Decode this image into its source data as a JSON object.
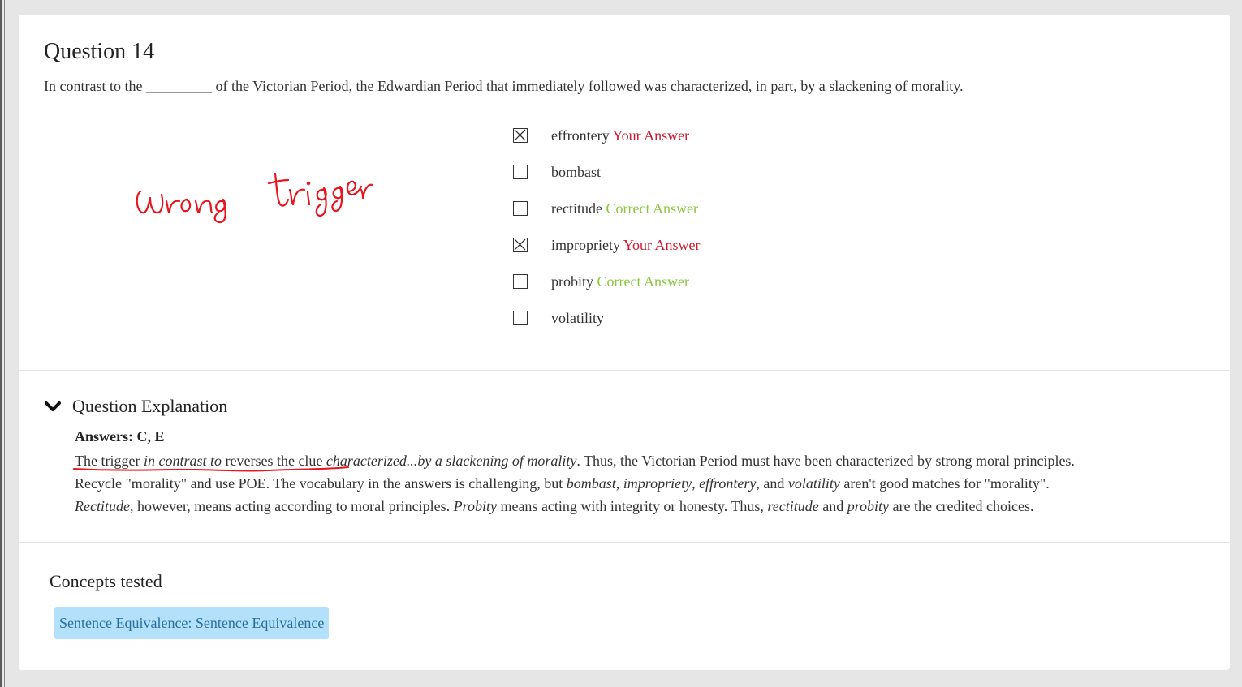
{
  "question": {
    "title": "Question 14",
    "stem": "In contrast to the _________ of the Victorian Period, the Edwardian Period that immediately followed was characterized, in part, by a slackening of morality."
  },
  "options": [
    {
      "text": "effrontery",
      "checked": true,
      "tag": "Your Answer",
      "tag_type": "wrong"
    },
    {
      "text": "bombast",
      "checked": false,
      "tag": "",
      "tag_type": ""
    },
    {
      "text": "rectitude",
      "checked": false,
      "tag": "Correct Answer",
      "tag_type": "right"
    },
    {
      "text": "impropriety",
      "checked": true,
      "tag": "Your Answer",
      "tag_type": "wrong"
    },
    {
      "text": "probity",
      "checked": false,
      "tag": "Correct Answer",
      "tag_type": "right"
    },
    {
      "text": "volatility",
      "checked": false,
      "tag": "",
      "tag_type": ""
    }
  ],
  "annotation": {
    "handwriting": "wrong trigger",
    "color": "#e8141e"
  },
  "explanation": {
    "heading": "Question Explanation",
    "answers": "Answers: C, E",
    "p1_a": "The trigger ",
    "p1_b": "in contrast to",
    "p1_c": " reverses the clue ",
    "p1_d": "characterized...by a slackening of morality",
    "p1_e": ". Thus, the Victorian Period must have been characterized by strong moral principles.",
    "p2_a": "Recycle \"morality\" and use POE. The vocabulary in the answers is challenging, but ",
    "p2_b": "bombast",
    "p2_c": ", ",
    "p2_d": "impropriety",
    "p2_e": ", ",
    "p2_f": "effrontery",
    "p2_g": ", and ",
    "p2_h": "volatility",
    "p2_i": " aren't good matches for \"morality\".",
    "p3_a": "Rectitude",
    "p3_b": ", however, means acting according to moral principles. ",
    "p3_c": "Probity",
    "p3_d": " means acting with integrity or honesty. Thus, ",
    "p3_e": "rectitude",
    "p3_f": " and ",
    "p3_g": "probity",
    "p3_h": " are the credited choices."
  },
  "concepts": {
    "heading": "Concepts tested",
    "chips": [
      "Sentence Equivalence: Sentence Equivalence"
    ]
  },
  "colors": {
    "wrong": "#d0192e",
    "right": "#8cc63f",
    "chip_bg": "#b3e1fb",
    "chip_text": "#2a6f9a"
  }
}
